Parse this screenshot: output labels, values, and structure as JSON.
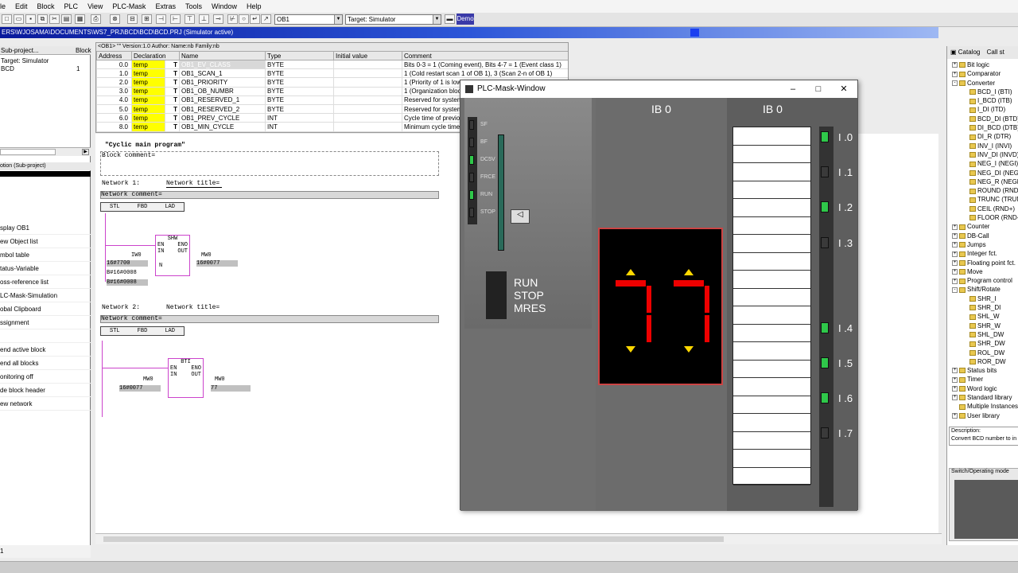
{
  "menu": [
    "le",
    "Edit",
    "Block",
    "PLC",
    "View",
    "PLC-Mask",
    "Extras",
    "Tools",
    "Window",
    "Help"
  ],
  "toolbar": {
    "block_combo": "OB1",
    "target_combo": "Target: Simulator",
    "demo": "Demo"
  },
  "titlebar": "ERS\\WJOSAMA\\DOCUMENTS\\WS7_PRJ\\BCD\\BCD\\BCD.PRJ  (Simulator active)",
  "left": {
    "header_a": "Sub-project...",
    "header_b": "Block",
    "target": "Target: Simulator",
    "row_name": "BCD",
    "row_val": "1",
    "sub_caption": "otion (Sub-project)",
    "items": [
      "splay OB1",
      "ew Object list",
      "mbol table",
      "tatus-Variable",
      "oss-reference list",
      "LC-Mask-Simulation",
      "obal Clipboard",
      "ssignment",
      "",
      "end active block",
      "end all blocks",
      "onitoring off",
      "de block header",
      "ew network"
    ],
    "status": "1"
  },
  "vartable": {
    "caption": "<OB1> \"\"   Version:1.0   Author:   Name:nb   Family:nb",
    "headers": [
      "Address",
      "Declaration",
      "Name",
      "Type",
      "Initial value",
      "Comment"
    ],
    "rows": [
      [
        "0.0",
        "temp",
        "T",
        "OB1_EV_CLASS",
        "BYTE",
        "",
        "Bits 0-3 = 1 (Coming event), Bits 4-7 = 1 (Event class 1)"
      ],
      [
        "1.0",
        "temp",
        "T",
        "OB1_SCAN_1",
        "BYTE",
        "",
        "1 (Cold restart scan 1 of OB 1), 3 (Scan 2-n of OB 1)"
      ],
      [
        "2.0",
        "temp",
        "T",
        "OB1_PRIORITY",
        "BYTE",
        "",
        "1 (Priority of 1 is lowest)"
      ],
      [
        "3.0",
        "temp",
        "T",
        "OB1_OB_NUMBR",
        "BYTE",
        "",
        "1 (Organization block 1, OB1)"
      ],
      [
        "4.0",
        "temp",
        "T",
        "OB1_RESERVED_1",
        "BYTE",
        "",
        "Reserved for system"
      ],
      [
        "5.0",
        "temp",
        "T",
        "OB1_RESERVED_2",
        "BYTE",
        "",
        "Reserved for system"
      ],
      [
        "6.0",
        "temp",
        "T",
        "OB1_PREV_CYCLE",
        "INT",
        "",
        "Cycle time of previous OB1 scan"
      ],
      [
        "8.0",
        "temp",
        "T",
        "OB1_MIN_CYCLE",
        "INT",
        "",
        "Minimum cycle time of OB1"
      ]
    ]
  },
  "code": {
    "main_title": "\"Cyclic main program\"",
    "block_comment": "Block comment=",
    "net1": "Network 1:",
    "net1_title": "Network title=",
    "net_comment": "Network comment=",
    "tabs": [
      "STL",
      "FBD",
      "LAD"
    ],
    "shw": {
      "name": "SHW",
      "en": "EN",
      "eno": "ENO",
      "in": "IN",
      "out": "OUT",
      "n": "N",
      "in_var": "IW0",
      "in_val": "16#7700",
      "out_var": "MW0",
      "out_val": "16#0077",
      "n_val": "B#16#0008",
      "n_val2": "B#16#0008"
    },
    "net2": "Network 2:",
    "net2_title": "Network title=",
    "bti": {
      "name": "BTI",
      "en": "EN",
      "eno": "ENO",
      "in": "IN",
      "out": "OUT",
      "in_var": "MW0",
      "in_val": "16#0077",
      "out_var": "MW0",
      "out_val": "77"
    }
  },
  "catalog": {
    "tab1": "Catalog",
    "tab2": "Call st",
    "items": [
      {
        "t": "Bit logic",
        "lvl": 1,
        "pm": "+"
      },
      {
        "t": "Comparator",
        "lvl": 1,
        "pm": "+"
      },
      {
        "t": "Converter",
        "lvl": 1,
        "pm": "-"
      },
      {
        "t": "BCD_I (BTI)",
        "lvl": 2
      },
      {
        "t": "I_BCD (ITB)",
        "lvl": 2
      },
      {
        "t": "I_DI (ITD)",
        "lvl": 2
      },
      {
        "t": "BCD_DI (BTD)",
        "lvl": 2
      },
      {
        "t": "DI_BCD (DTB)",
        "lvl": 2
      },
      {
        "t": "DI_R (DTR)",
        "lvl": 2
      },
      {
        "t": "INV_I (INVI)",
        "lvl": 2
      },
      {
        "t": "INV_DI (INVD)",
        "lvl": 2
      },
      {
        "t": "NEG_I (NEGI)",
        "lvl": 2
      },
      {
        "t": "NEG_DI (NEGD)",
        "lvl": 2
      },
      {
        "t": "NEG_R (NEGR)",
        "lvl": 2
      },
      {
        "t": "ROUND (RND)",
        "lvl": 2
      },
      {
        "t": "TRUNC (TRUNC)",
        "lvl": 2
      },
      {
        "t": "CEIL (RND+)",
        "lvl": 2
      },
      {
        "t": "FLOOR (RND-)",
        "lvl": 2
      },
      {
        "t": "Counter",
        "lvl": 1,
        "pm": "+"
      },
      {
        "t": "DB-Call",
        "lvl": 1,
        "pm": "+"
      },
      {
        "t": "Jumps",
        "lvl": 1,
        "pm": "+"
      },
      {
        "t": "Integer fct.",
        "lvl": 1,
        "pm": "+"
      },
      {
        "t": "Floating point fct.",
        "lvl": 1,
        "pm": "+"
      },
      {
        "t": "Move",
        "lvl": 1,
        "pm": "+"
      },
      {
        "t": "Program control",
        "lvl": 1,
        "pm": "+"
      },
      {
        "t": "Shift/Rotate",
        "lvl": 1,
        "pm": "-"
      },
      {
        "t": "SHR_I",
        "lvl": 2
      },
      {
        "t": "SHR_DI",
        "lvl": 2
      },
      {
        "t": "SHL_W",
        "lvl": 2
      },
      {
        "t": "SHR_W",
        "lvl": 2
      },
      {
        "t": "SHL_DW",
        "lvl": 2
      },
      {
        "t": "SHR_DW",
        "lvl": 2
      },
      {
        "t": "ROL_DW",
        "lvl": 2
      },
      {
        "t": "ROR_DW",
        "lvl": 2
      },
      {
        "t": "Status bits",
        "lvl": 1,
        "pm": "+"
      },
      {
        "t": "Timer",
        "lvl": 1,
        "pm": "+"
      },
      {
        "t": "Word logic",
        "lvl": 1,
        "pm": "+"
      },
      {
        "t": "Standard library",
        "lvl": 1,
        "pm": "+"
      },
      {
        "t": "Multiple Instances",
        "lvl": 1,
        "pm": ""
      },
      {
        "t": "User library",
        "lvl": 1,
        "pm": "+"
      }
    ],
    "desc_label": "Description:",
    "desc_text": "Convert BCD number to in",
    "switch_label": "Switch/Operating mode"
  },
  "plc": {
    "title": "PLC-Mask-Window",
    "cpu_leds": [
      "SF",
      "BF",
      "DC5V",
      "FRCE",
      "RUN",
      "STOP"
    ],
    "mode_labels": [
      "RUN",
      "STOP",
      "MRES"
    ],
    "ib0_label": "IB 0",
    "ib0b_label": "IB 0",
    "inputs": [
      "I .0",
      "I .1",
      "I .2",
      "I .3",
      "I .4",
      "I .5",
      "I .6",
      "I .7"
    ],
    "input_states": [
      true,
      false,
      true,
      false,
      true,
      true,
      true,
      false
    ]
  }
}
